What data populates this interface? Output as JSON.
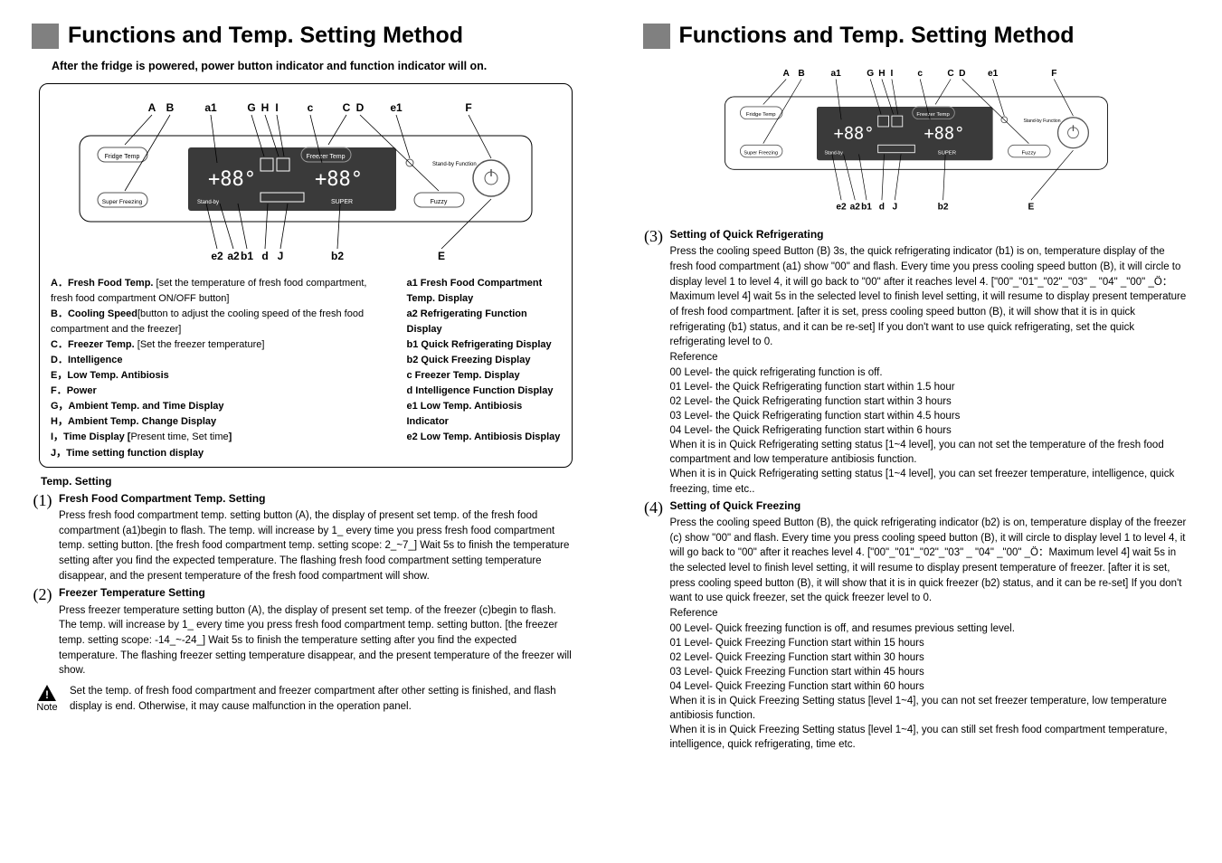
{
  "left": {
    "title": "Functions and Temp. Setting Method",
    "subtitle": "After the fridge is powered, power button indicator and function indicator will on.",
    "legend_left": "<b>A．Fresh Food Temp.</b> [set the temperature of fresh food compartment, fresh food compartment ON/OFF button]<br><b>B．Cooling Speed</b>[button to adjust the cooling speed of the fresh food compartment and the freezer]<br><b>C．Freezer Temp.</b> [Set the freezer temperature]<br><b>D．Intelligence</b><br><b>E，Low Temp. Antibiosis</b><br><b>F．Power</b><br><b>G，Ambient Temp. and Time Display</b><br><b>H，Ambient Temp. Change Display</b><br><b>I，Time Display [</b>Present time, Set time<b>]</b><br><b>J，Time setting function display</b>",
    "legend_right": "<b>a1 Fresh Food Compartment Temp. Display<br>a2 Refrigerating Function Display<br>b1 Quick Refrigerating Display<br>b2 Quick Freezing Display<br>c  Freezer Temp. Display<br>d  Intelligence Function Display<br>e1 Low Temp. Antibiosis Indicator<br>e2 Low Temp. Antibiosis Display</b>",
    "temp_setting": "Temp. Setting",
    "s1_head": "Fresh Food Compartment Temp. Setting",
    "s1_body": "Press fresh food compartment temp. setting button (A), the display of present set temp. of the fresh food compartment (a1)begin to flash. The temp. will increase by 1_ every time you press fresh food compartment temp. setting button. [the fresh food compartment temp. setting scope: 2_~7_] Wait 5s to finish the temperature setting after you find the expected temperature. The flashing fresh food compartment setting temperature disappear, and the present temperature of the fresh food compartment will show.",
    "s2_head": "Freezer Temperature Setting",
    "s2_body": "Press freezer temperature setting button (A), the display of present set temp. of the freezer (c)begin to flash. The temp. will increase by 1_ every time you press fresh food compartment temp. setting button. [the freezer temp. setting scope: -14_~-24_] Wait 5s to finish the temperature setting after you find the expected temperature. The flashing freezer setting temperature disappear, and the present temperature of the freezer will show.",
    "note_label": "Note",
    "note_body": "Set the temp. of fresh food compartment and freezer compartment after other setting is finished, and flash display is end. Otherwise, it may cause malfunction in the operation panel."
  },
  "right": {
    "title": "Functions and Temp. Setting Method",
    "s3_head": "Setting of Quick Refrigerating",
    "s3_body": "Press the cooling speed Button (B) 3s, the quick refrigerating indicator (b1) is on, temperature display of the fresh food compartment (a1) show \"00\" and flash. Every time you press cooling speed button (B), it will circle to display level 1 to level 4, it will go back to \"00\" after it reaches level 4. [\"00\"_\"01\"_\"02\"_\"03\" _ \"04\" _\"00\" _Ö：Maximum level 4] wait 5s in the selected level to finish level setting, it will resume to display present temperature of fresh food compartment. [after it is set, press cooling speed button (B), it will show that it is in quick refrigerating (b1) status, and it can be re-set] If you don't want to use quick refrigerating, set the quick refrigerating level to 0.",
    "s3_ref_head": "Reference",
    "s3_refs": [
      "00 Level- the quick refrigerating function is off.",
      "01 Level- the Quick Refrigerating function start within 1.5 hour",
      "02 Level- the Quick Refrigerating function start within 3 hours",
      "03 Level- the Quick Refrigerating function start within 4.5 hours",
      "04 Level- the Quick Refrigerating function start within 6 hours",
      "When it is in Quick Refrigerating setting status [1~4 level], you can not set the temperature of the fresh food compartment and low temperature antibiosis function.",
      "When it is in Quick Refrigerating setting status [1~4 level], you can set freezer temperature, intelligence, quick freezing, time etc.."
    ],
    "s4_head": "Setting of Quick Freezing",
    "s4_body": "Press the cooling speed Button (B), the quick refrigerating indicator (b2) is on, temperature display of the freezer (c) show \"00\" and flash. Every time you press cooling speed button (B), it will circle to display level 1 to level 4, it will go back to \"00\" after it reaches level 4. [\"00\"_\"01\"_\"02\"_\"03\" _ \"04\" _\"00\" _Ö：Maximum level 4] wait 5s in the selected level to finish level setting, it will resume to display present temperature of freezer. [after it is set, press cooling speed button (B), it will show that it is in quick freezer (b2) status, and it can be re-set] If you don't want to use quick freezer, set the quick freezer level to 0.",
    "s4_ref_head": "Reference",
    "s4_refs": [
      "00 Level- Quick freezing function is off, and resumes previous setting level.",
      "01 Level- Quick Freezing Function start within 15 hours",
      "02 Level- Quick Freezing Function start within 30 hours",
      "03 Level- Quick Freezing Function start within 45 hours",
      "04 Level- Quick Freezing Function start within 60 hours",
      "When it is in Quick Freezing Setting status [level 1~4], you can not set freezer temperature, low temperature antibiosis function.",
      "When it is in Quick Freezing Setting status [level 1~4], you can still set fresh food compartment temperature, intelligence, quick refrigerating, time etc."
    ]
  },
  "panel": {
    "btnFridge": "Fridge Temp",
    "btnFreezer": "Freezer Temp",
    "btnSuper": "Super Freezing",
    "btnFuzzy": "Fuzzy",
    "standby": "Stand-by Function",
    "super_small": "SUPER",
    "standby_small": "Stand-by",
    "topLabels": [
      "A",
      "B",
      "a1",
      "G",
      "H",
      "I",
      "c",
      "C",
      "D",
      "e1",
      "F"
    ],
    "botLabels": [
      "e2",
      "a2",
      "b1",
      "d",
      "J",
      "b2",
      "E"
    ]
  }
}
